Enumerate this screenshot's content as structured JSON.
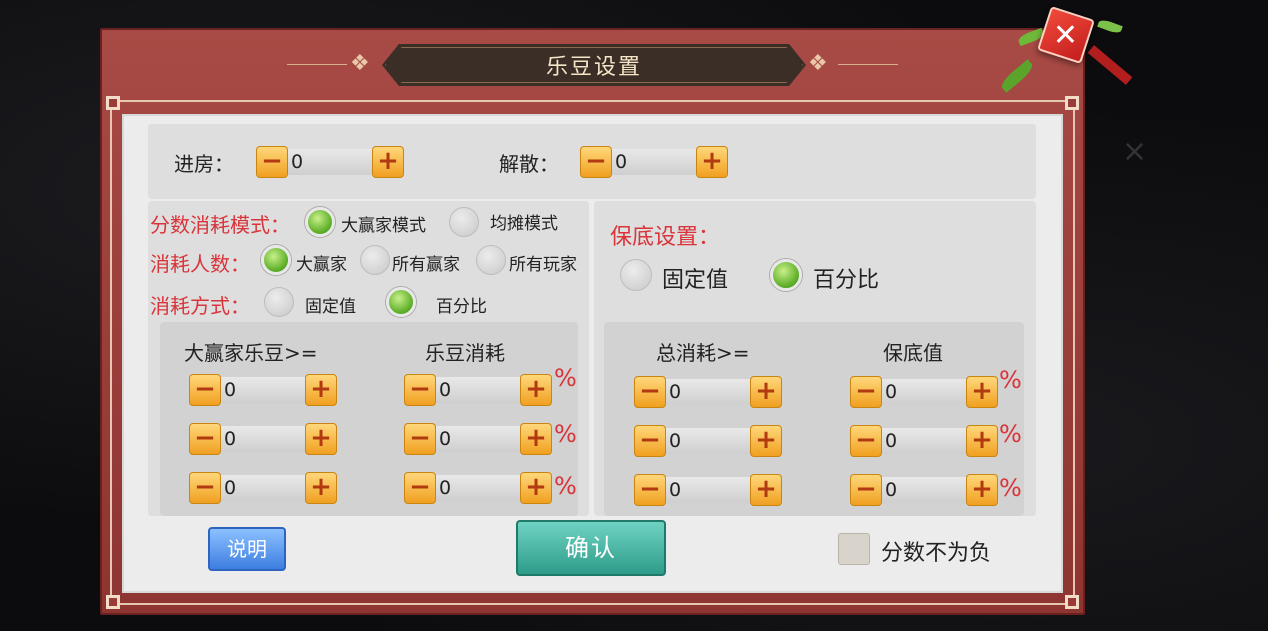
{
  "dialog": {
    "title": "乐豆设置",
    "close_label": "✕"
  },
  "top": {
    "enter_label": "进房：",
    "enter_value": "0",
    "dissolve_label": "解散：",
    "dissolve_value": "0"
  },
  "left": {
    "score_mode_label": "分数消耗模式：",
    "score_mode_options": [
      "大赢家模式",
      "均摊模式"
    ],
    "score_mode_selected": "大赢家模式",
    "people_label": "消耗人数：",
    "people_options": [
      "大赢家",
      "所有赢家",
      "所有玩家"
    ],
    "people_selected": "大赢家",
    "method_label": "消耗方式：",
    "method_options": [
      "固定值",
      "百分比"
    ],
    "method_selected": "百分比",
    "col1_header": "大赢家乐豆>=",
    "col2_header": "乐豆消耗",
    "rows": [
      {
        "threshold": "0",
        "cost": "0",
        "unit": "%"
      },
      {
        "threshold": "0",
        "cost": "0",
        "unit": "%"
      },
      {
        "threshold": "0",
        "cost": "0",
        "unit": "%"
      }
    ]
  },
  "right": {
    "guarantee_label": "保底设置：",
    "guarantee_options": [
      "固定值",
      "百分比"
    ],
    "guarantee_selected": "百分比",
    "col1_header": "总消耗>=",
    "col2_header": "保底值",
    "rows": [
      {
        "threshold": "0",
        "value": "0",
        "unit": "%"
      },
      {
        "threshold": "0",
        "value": "0",
        "unit": "%"
      },
      {
        "threshold": "0",
        "value": "0",
        "unit": "%"
      }
    ]
  },
  "footer": {
    "explain_label": "说明",
    "confirm_label": "确认",
    "nonneg_label": "分数不为负",
    "nonneg_checked": false
  },
  "stepper": {
    "minus": "−",
    "plus": "+"
  },
  "colors": {
    "frame": "#9b3b37",
    "accent_red": "#d8343a",
    "confirm": "#2e9c8a",
    "explain": "#3d7ee0",
    "stepper": "#f0a020"
  }
}
